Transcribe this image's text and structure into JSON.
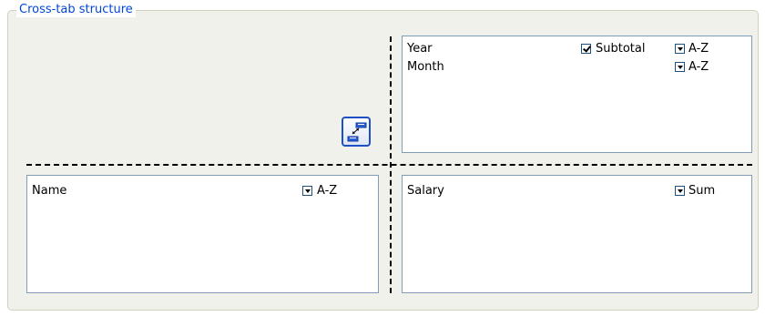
{
  "group": {
    "title": "Cross-tab structure"
  },
  "columns_box": {
    "rows": [
      {
        "name": "Year",
        "subtotal_label": "Subtotal",
        "subtotal_checked": true,
        "sort": "A-Z"
      },
      {
        "name": "Month",
        "sort": "A-Z"
      }
    ]
  },
  "rows_box": {
    "rows": [
      {
        "name": "Name",
        "sort": "A-Z"
      }
    ]
  },
  "values_box": {
    "rows": [
      {
        "name": "Salary",
        "aggregate": "Sum"
      }
    ]
  },
  "icons": {
    "swap": "swap-axes-icon",
    "dropdown": "dropdown-arrow-icon",
    "checkbox": "checkbox-checked-icon"
  }
}
